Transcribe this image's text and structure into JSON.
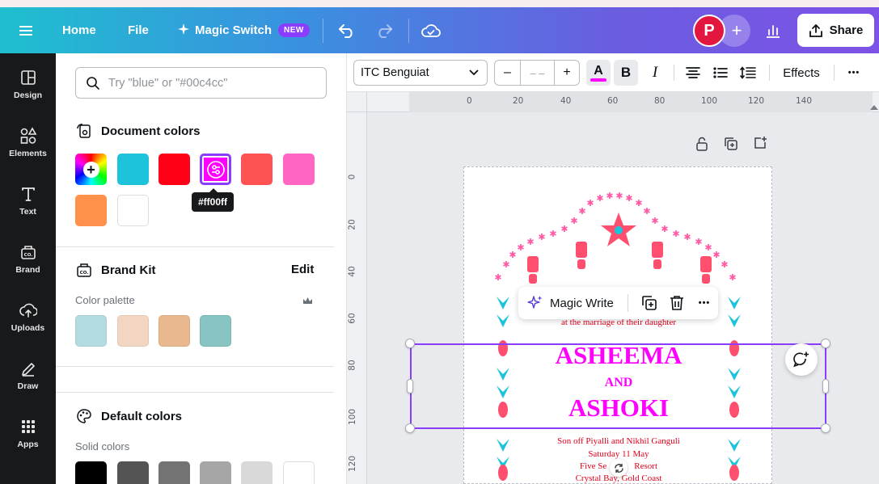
{
  "topbar": {
    "home": "Home",
    "file": "File",
    "magic_switch": "Magic Switch",
    "new_badge": "NEW",
    "avatar_initial": "P",
    "share": "Share"
  },
  "rail": [
    {
      "label": "Design",
      "icon": "design-icon"
    },
    {
      "label": "Elements",
      "icon": "elements-icon"
    },
    {
      "label": "Text",
      "icon": "text-icon"
    },
    {
      "label": "Brand",
      "icon": "brand-icon"
    },
    {
      "label": "Uploads",
      "icon": "uploads-icon"
    },
    {
      "label": "Draw",
      "icon": "draw-icon"
    },
    {
      "label": "Apps",
      "icon": "apps-icon"
    }
  ],
  "panel": {
    "search_placeholder": "Try \"blue\" or \"#00c4cc\"",
    "document_colors_title": "Document colors",
    "document_colors": [
      "#1cc3db",
      "#ff0016",
      "#ff00ff",
      "#ff5252",
      "#ff66c4",
      "#ff914d",
      "#ffffff"
    ],
    "tooltip": "#ff00ff",
    "brand_kit_title": "Brand Kit",
    "brand_kit_edit": "Edit",
    "color_palette_label": "Color palette",
    "brand_colors": [
      "#b4dce0",
      "#f3d6c1",
      "#e8b88e",
      "#87c4c2"
    ],
    "default_colors_title": "Default colors",
    "solid_colors_label": "Solid colors",
    "solid_colors": [
      "#000000",
      "#545454",
      "#737373",
      "#a6a6a6",
      "#d9d9d9",
      "#ffffff"
    ]
  },
  "toolbar": {
    "font_name": "ITC Benguiat",
    "size_minus": "–",
    "size_value": "– –",
    "size_plus": "+",
    "text_color_letter": "A",
    "bold": "B",
    "italic": "I",
    "effects": "Effects",
    "more": "•••"
  },
  "ruler": {
    "top": [
      "0",
      "20",
      "40",
      "60",
      "80",
      "100",
      "120",
      "140"
    ],
    "left": [
      "0",
      "20",
      "40",
      "60",
      "80",
      "100",
      "120"
    ]
  },
  "context_menu": {
    "magic_write": "Magic Write"
  },
  "invitation": {
    "line_top": "at the marriage of their daughter",
    "name1": "ASHEEMA",
    "and": "AND",
    "name2": "ASHOKI",
    "line1": "Son off Piyalli and Nikhil Ganguli",
    "line2": "Saturday 11 May",
    "line3": "Five Se",
    "line3b": "Resort",
    "line4": "Crystal Bay, Gold Coast"
  },
  "colors": {
    "accent": "#8b3dff",
    "magenta": "#ff00ff",
    "red_text": "#e0001b",
    "teal": "#1cc3db",
    "pink": "#ff5aa5"
  }
}
